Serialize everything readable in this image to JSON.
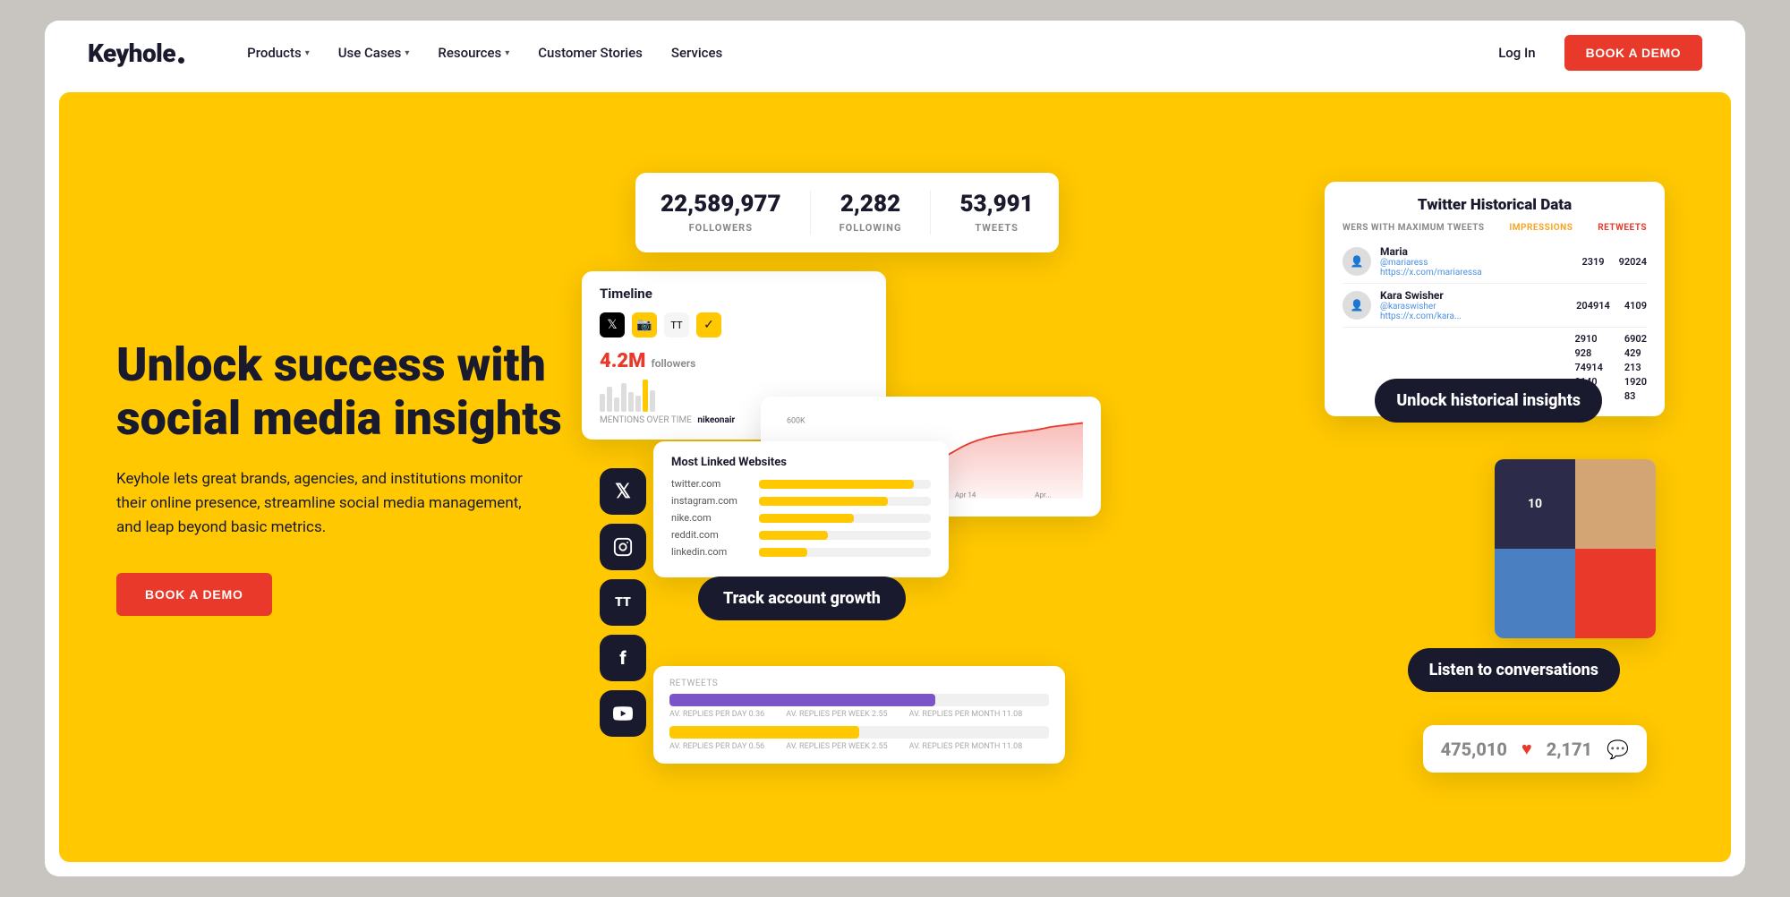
{
  "logo": {
    "text": "Keyhole",
    "has_dot": true
  },
  "nav": {
    "items": [
      {
        "label": "Products",
        "has_chevron": true
      },
      {
        "label": "Use Cases",
        "has_chevron": true
      },
      {
        "label": "Resources",
        "has_chevron": true
      },
      {
        "label": "Customer Stories",
        "has_chevron": false
      },
      {
        "label": "Services",
        "has_chevron": false
      }
    ],
    "login_label": "Log In",
    "demo_label": "BOOK A DEMO"
  },
  "hero": {
    "title": "Unlock success with social media insights",
    "subtitle": "Keyhole lets great brands, agencies, and institutions monitor their online presence, streamline social media management, and leap beyond basic metrics.",
    "cta_label": "BOOK A DEMO",
    "stats_card": {
      "followers": "22,589,977",
      "followers_label": "FOLLOWERS",
      "following": "2,282",
      "following_label": "FOLLOWING",
      "tweets": "53,991",
      "tweets_label": "TWEETS"
    },
    "timeline": {
      "title": "Timeline",
      "followers_count": "4.2M",
      "followers_label": "followers",
      "mentions_label": "MENTIONS OVER TIME",
      "mentions_tag": "nikeonair"
    },
    "historical": {
      "title": "Twitter Historical Data",
      "subheader_left": "WERS WITH MAXIMUM TWEETS",
      "col_impressions": "Impressions",
      "col_retweets": "Retweets",
      "users": [
        {
          "name": "Maria",
          "handle": "@mariaress",
          "url": "https://x.com/mariaressa",
          "impressions": "2319",
          "retweets": "92024"
        },
        {
          "name": "Kara Swisher",
          "handle": "@karaswisher",
          "url": "https://x.com/kara...",
          "impressions": "204914",
          "retweets": "4109"
        }
      ],
      "numbers": [
        "2910",
        "928",
        "74914",
        "9140"
      ],
      "numbers2": [
        "6902",
        "429",
        "213",
        "1920",
        "83"
      ]
    },
    "badge_unlock": "Unlock historical insights",
    "badge_track": "Track account growth",
    "badge_listen": "Listen to conversations",
    "linked_websites": {
      "title": "Most Linked Websites",
      "items": [
        {
          "site": "twitter.com",
          "pct": 90
        },
        {
          "site": "instagram.com",
          "pct": 75
        },
        {
          "site": "nike.com",
          "pct": 55
        },
        {
          "site": "reddit.com",
          "pct": 40
        },
        {
          "site": "linkedin.com",
          "pct": 28
        }
      ]
    },
    "engagement": {
      "likes": "475,010",
      "comments": "2,171"
    }
  }
}
